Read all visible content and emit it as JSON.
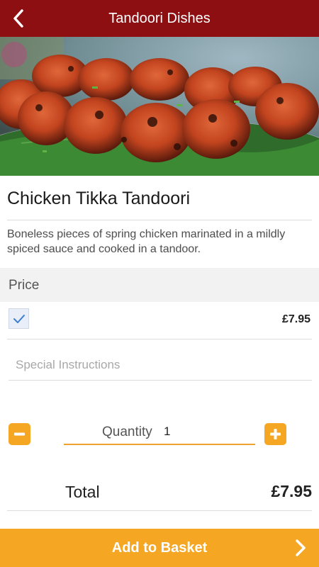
{
  "header": {
    "title": "Tandoori Dishes",
    "back_icon": "chevron-left-icon",
    "background": "#8d0f12"
  },
  "dish": {
    "name": "Chicken Tikka Tandoori",
    "description": "Boneless pieces of spring chicken marinated in a mildly spiced sauce and cooked in a tandoor.",
    "image": "chicken-tikka-photo"
  },
  "price_section": {
    "label": "Price",
    "option_checked": true,
    "option_price": "£7.95"
  },
  "instructions": {
    "placeholder": "Special Instructions",
    "value": ""
  },
  "quantity": {
    "label": "Quantity",
    "value": "1",
    "decrement_icon": "minus-icon",
    "increment_icon": "plus-icon"
  },
  "total": {
    "label": "Total",
    "value": "£7.95"
  },
  "basket": {
    "label": "Add to Basket",
    "arrow_icon": "chevron-right-icon"
  },
  "colors": {
    "header": "#8d0f12",
    "accent": "#f5a623"
  }
}
